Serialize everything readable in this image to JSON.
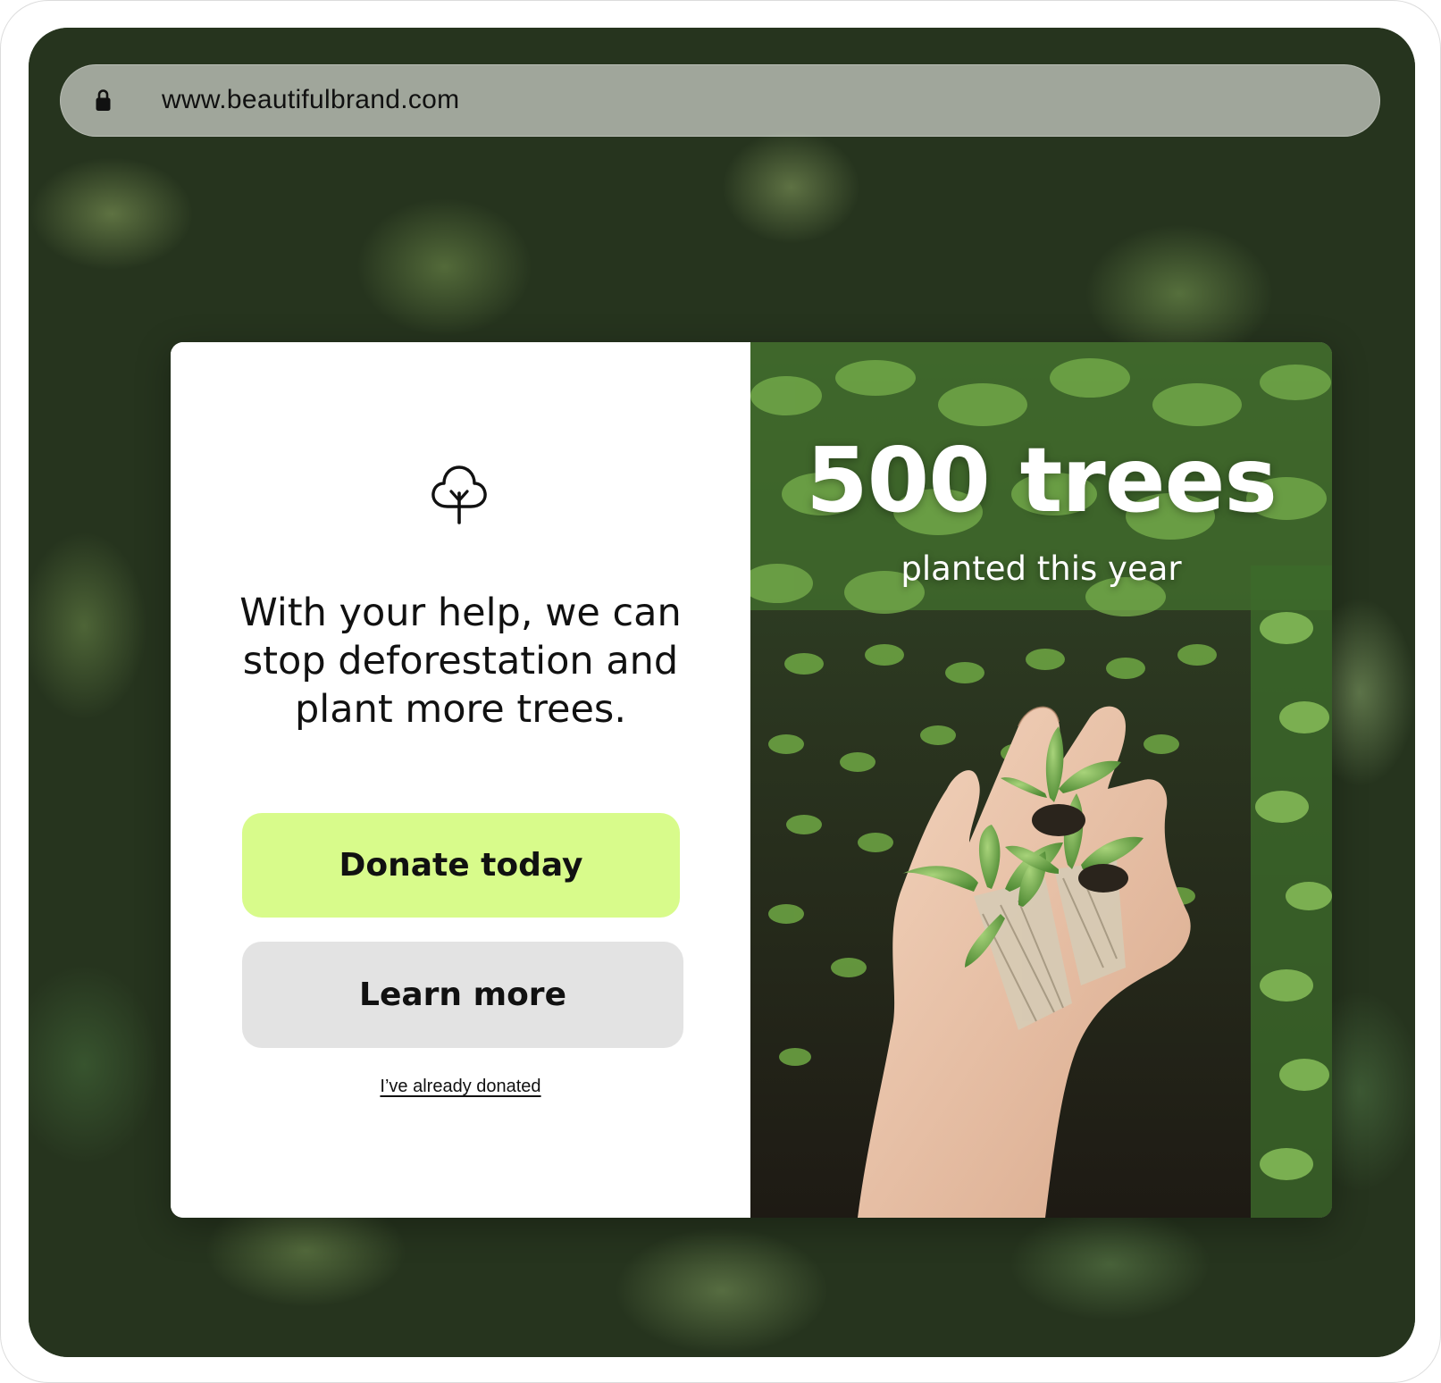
{
  "browser": {
    "url": "www.beautifulbrand.com",
    "lock_icon": "lock-icon"
  },
  "promo": {
    "icon": "tree-icon",
    "headline": "With your help, we can stop deforestation and plant more trees.",
    "donate_label": "Donate today",
    "learn_label": "Learn more",
    "already_donated_label": "I’ve already donated",
    "stat_value": "500 trees",
    "stat_label": "planted this year"
  },
  "colors": {
    "donate_button": "#d8fb8b",
    "learn_button": "#e3e3e3",
    "text": "#111111",
    "card_background": "#ffffff"
  }
}
